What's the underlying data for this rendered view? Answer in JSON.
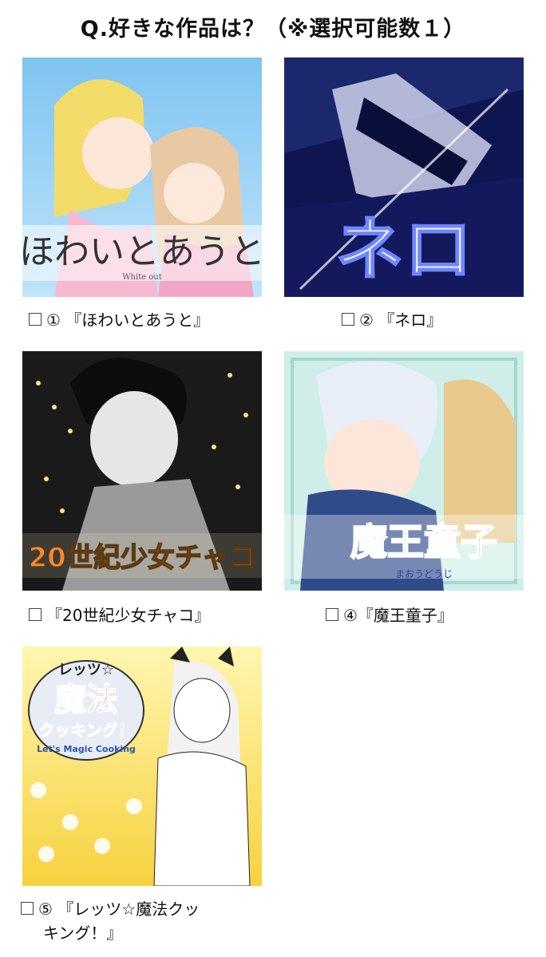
{
  "title": "Q.好きな作品は？（※選択可能数１）",
  "options": [
    {
      "label": "① 『ほわいとあうと』",
      "cover_text": "ほわいとあうと",
      "cover_subtext": "White out"
    },
    {
      "label": "② 『ネロ』",
      "cover_text": "ネロ"
    },
    {
      "label": "『20世紀少女チャコ』",
      "cover_text": "20世紀少女チャコ"
    },
    {
      "label": "④『魔王童子』",
      "cover_text": "魔王童子",
      "cover_subtext": "まおうどうじ"
    },
    {
      "label": "⑤ 『レッツ☆魔法クッキング！』",
      "label_line1": "⑤ 『レッツ☆魔法クッ",
      "label_line2": "キング！』",
      "cover_text_top": "レッツ☆",
      "cover_text_main": "魔法",
      "cover_text_bottom": "クッキング！",
      "cover_subtext": "Let's Magic Cooking"
    }
  ]
}
